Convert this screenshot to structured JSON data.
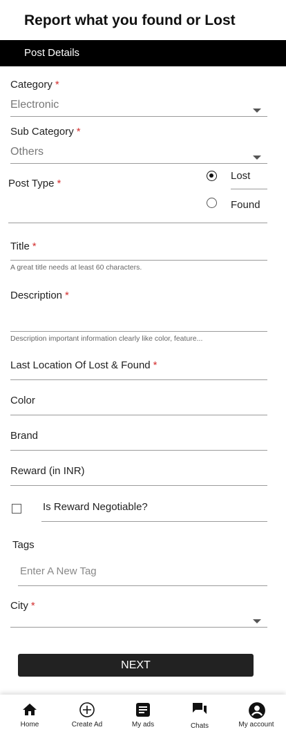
{
  "header": {
    "title": "Report what you found or Lost"
  },
  "section": {
    "title": "Post Details"
  },
  "form": {
    "category": {
      "label": "Category",
      "value": "Electronic"
    },
    "sub_category": {
      "label": "Sub Category",
      "value": "Others"
    },
    "post_type": {
      "label": "Post Type",
      "options": [
        "Lost",
        "Found"
      ],
      "selected": "Lost"
    },
    "title": {
      "label": "Title",
      "help": "A great title needs at least 60 characters."
    },
    "description": {
      "label": "Description",
      "help": "Description important information clearly like color, feature..."
    },
    "last_location": {
      "label": "Last Location Of Lost & Found"
    },
    "color": {
      "label": "Color"
    },
    "brand": {
      "label": "Brand"
    },
    "reward": {
      "label": "Reward (in INR)"
    },
    "reward_negotiable": {
      "label": "Is Reward Negotiable?",
      "checked": false
    },
    "tags": {
      "label": "Tags",
      "placeholder": "Enter A New Tag"
    },
    "city": {
      "label": "City",
      "value": ""
    },
    "required_mark": "*"
  },
  "next_button": {
    "label": "NEXT"
  },
  "bottom_nav": [
    {
      "label": "Home",
      "icon": "home-icon"
    },
    {
      "label": "Create Ad",
      "icon": "plus-circle-icon"
    },
    {
      "label": "My ads",
      "icon": "article-icon"
    },
    {
      "label": "Chats",
      "icon": "chats-icon"
    },
    {
      "label": "My account",
      "icon": "account-circle-icon"
    }
  ]
}
